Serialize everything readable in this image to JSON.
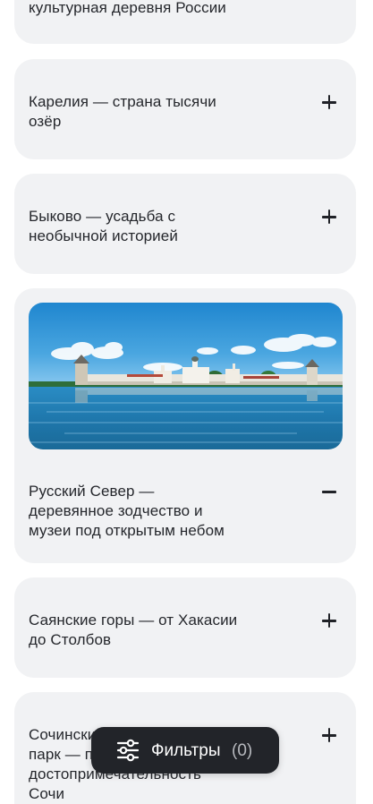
{
  "accordion": {
    "items": [
      {
        "title": "культурная деревня России",
        "state": "collapsed"
      },
      {
        "title_lines": [
          "Карелия — страна тысячи",
          "озёр"
        ],
        "toggle": "plus-icon"
      },
      {
        "title_lines": [
          "Быково — усадьба с",
          "необычной историей"
        ],
        "toggle": "plus-icon"
      },
      {
        "title_lines": [
          "Русский Север —",
          "деревянное зодчество и",
          "музеи под открытым небом"
        ],
        "toggle": "minus-icon",
        "image": "kirillo-belozersky-monastery-lake-photo"
      },
      {
        "title_lines": [
          "Саянские горы — от Хакасии",
          "до Столбов"
        ],
        "toggle": "plus-icon"
      },
      {
        "title_lines": [
          "Сочинский",
          "парк — п",
          "достопримечательность",
          "Сочи"
        ],
        "toggle": "plus-icon"
      }
    ]
  },
  "filters_button": {
    "label": "Фильтры",
    "count": "(0)",
    "icon": "sliders-icon"
  },
  "colors": {
    "card_background": "#f1f2f4",
    "text": "#25272c",
    "button_background": "#222429",
    "button_count": "#b7b9be"
  }
}
